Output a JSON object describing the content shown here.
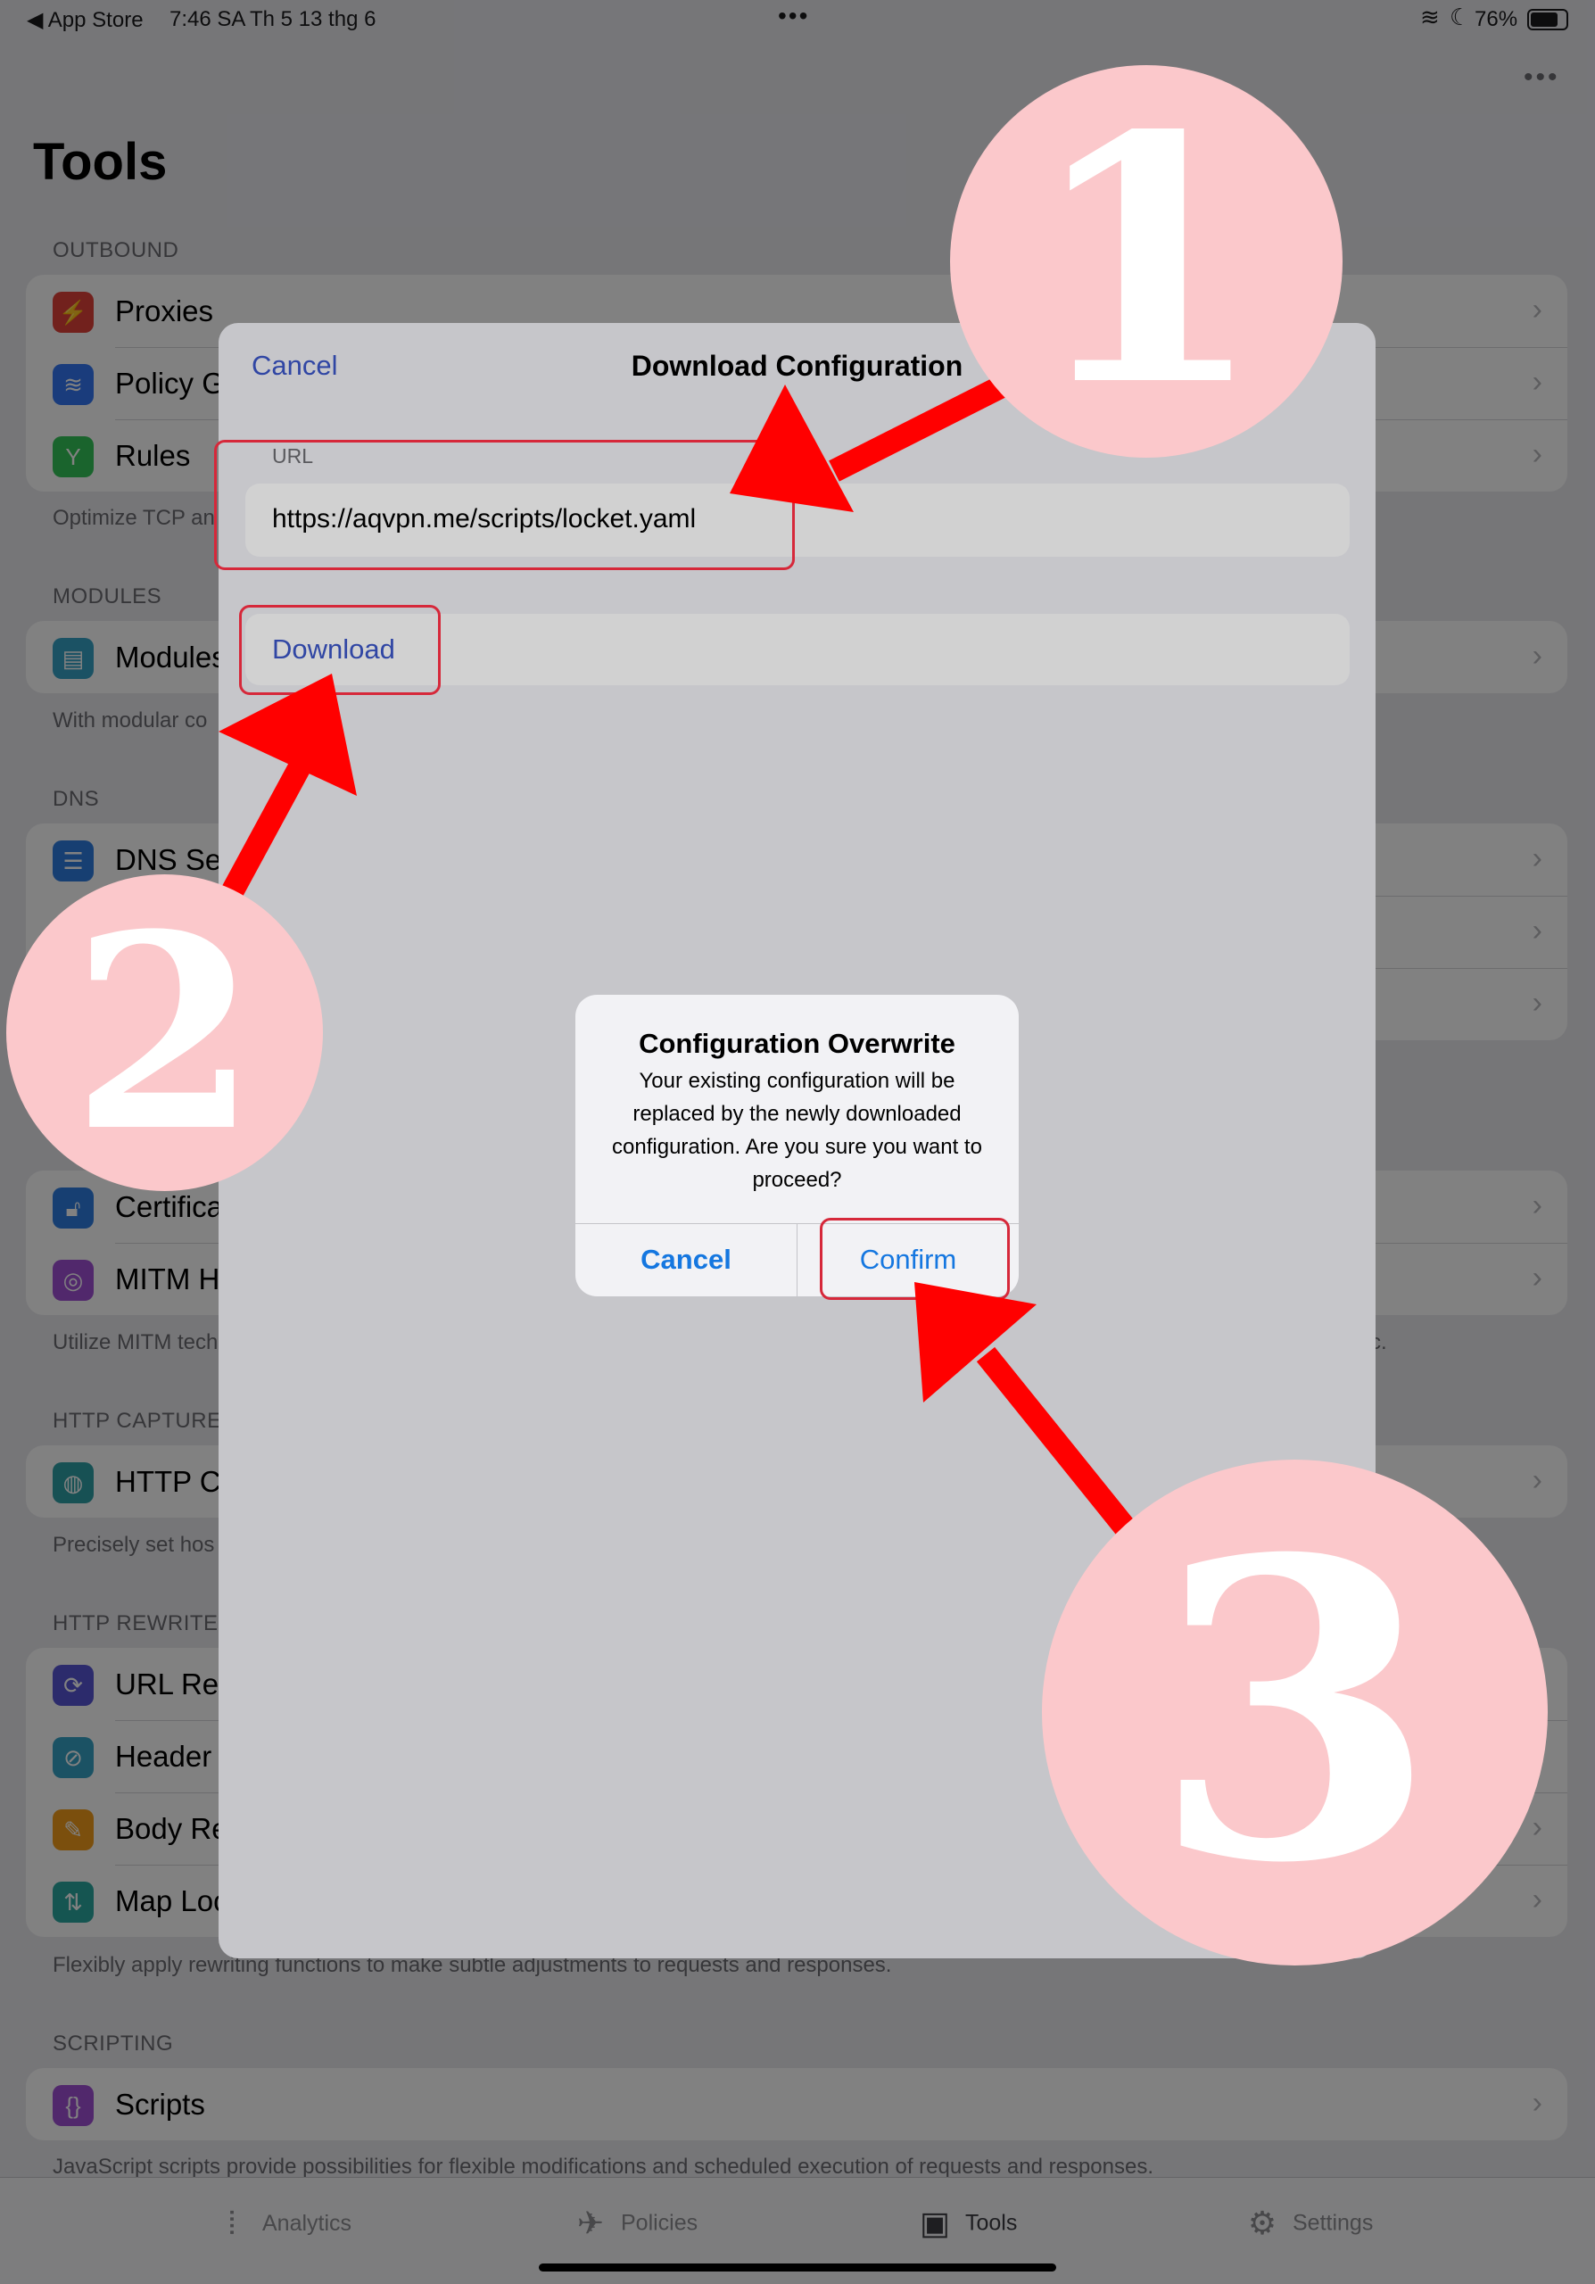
{
  "status_bar": {
    "back_app": "◀ App Store",
    "time": "7:46 SA",
    "date": "Th 5 13 thg 6",
    "battery": "76%"
  },
  "background": {
    "title": "Tools",
    "sections": {
      "outbound": {
        "header": "OUTBOUND",
        "items": [
          "Proxies",
          "Policy G",
          "Rules"
        ],
        "footer": "Optimize TCP an"
      },
      "modules": {
        "header": "MODULES",
        "items": [
          "Modules"
        ],
        "footer": "With modular co"
      },
      "dns": {
        "header": "DNS",
        "items": [
          "DNS Ser"
        ]
      },
      "mitm": {
        "items": [
          "Certifica",
          "MITM Ho"
        ],
        "footer": "Utilize MITM tech",
        "footer_tail": "c."
      },
      "http_capture": {
        "header": "HTTP CAPTURE",
        "items": [
          "HTTP Ca"
        ],
        "footer": "Precisely set hos"
      },
      "http_rewrite": {
        "header": "HTTP REWRITE",
        "items": [
          "URL Rew",
          "Header I",
          "Body Re",
          "Map Loc"
        ],
        "footer": "Flexibly apply rewriting functions to make subtle adjustments to requests and responses."
      },
      "scripting": {
        "header": "SCRIPTING",
        "items": [
          "Scripts"
        ],
        "footer": "JavaScript scripts provide possibilities for flexible modifications and scheduled execution of requests and responses."
      }
    }
  },
  "tab_bar": {
    "tabs": [
      "Analytics",
      "Policies",
      "Tools",
      "Settings"
    ]
  },
  "sheet": {
    "cancel_label": "Cancel",
    "title": "Download Configuration",
    "url_label": "URL",
    "url_value": "https://aqvpn.me/scripts/locket.yaml",
    "download_label": "Download"
  },
  "alert": {
    "title": "Configuration Overwrite",
    "message": "Your existing configuration will be replaced by the newly downloaded configuration. Are you sure you want to proceed?",
    "cancel_label": "Cancel",
    "confirm_label": "Confirm"
  },
  "annotations": {
    "step1": "1",
    "step2": "2",
    "step3": "3"
  },
  "colors": {
    "accent_blue": "#1577e0",
    "link_indigo": "#3b56c8",
    "highlight_red": "#d6283a",
    "arrow_red": "#ff0000",
    "circle_pink": "#fbc8cb"
  }
}
